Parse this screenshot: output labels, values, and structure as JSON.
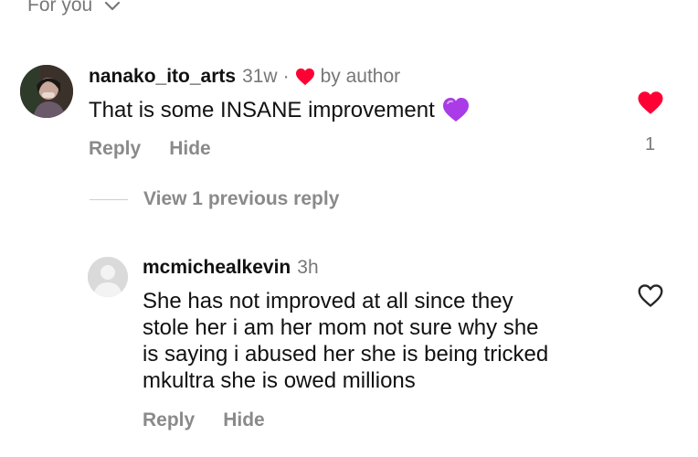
{
  "sort": {
    "label": "For you"
  },
  "comment": {
    "username": "nanako_ito_arts",
    "time": "31w",
    "separator": "·",
    "liked_by": "by author",
    "text": "That is some INSANE improvement",
    "emoji": "purple-heart",
    "reply_label": "Reply",
    "hide_label": "Hide",
    "like_count": "1",
    "liked": true
  },
  "view_previous": {
    "label": "View 1 previous reply"
  },
  "reply": {
    "username": "mcmichealkevin",
    "time": "3h",
    "lines": [
      "She has not improved at all since they",
      "stole her i am her mom not sure why she",
      "is saying i abused her she is being tricked",
      "mkultra she is owed millions"
    ],
    "reply_label": "Reply",
    "hide_label": "Hide",
    "liked": false
  },
  "colors": {
    "like_red": "#ff0034",
    "purple_heart": "#a93ce6",
    "muted_text": "#8a8a8a"
  }
}
